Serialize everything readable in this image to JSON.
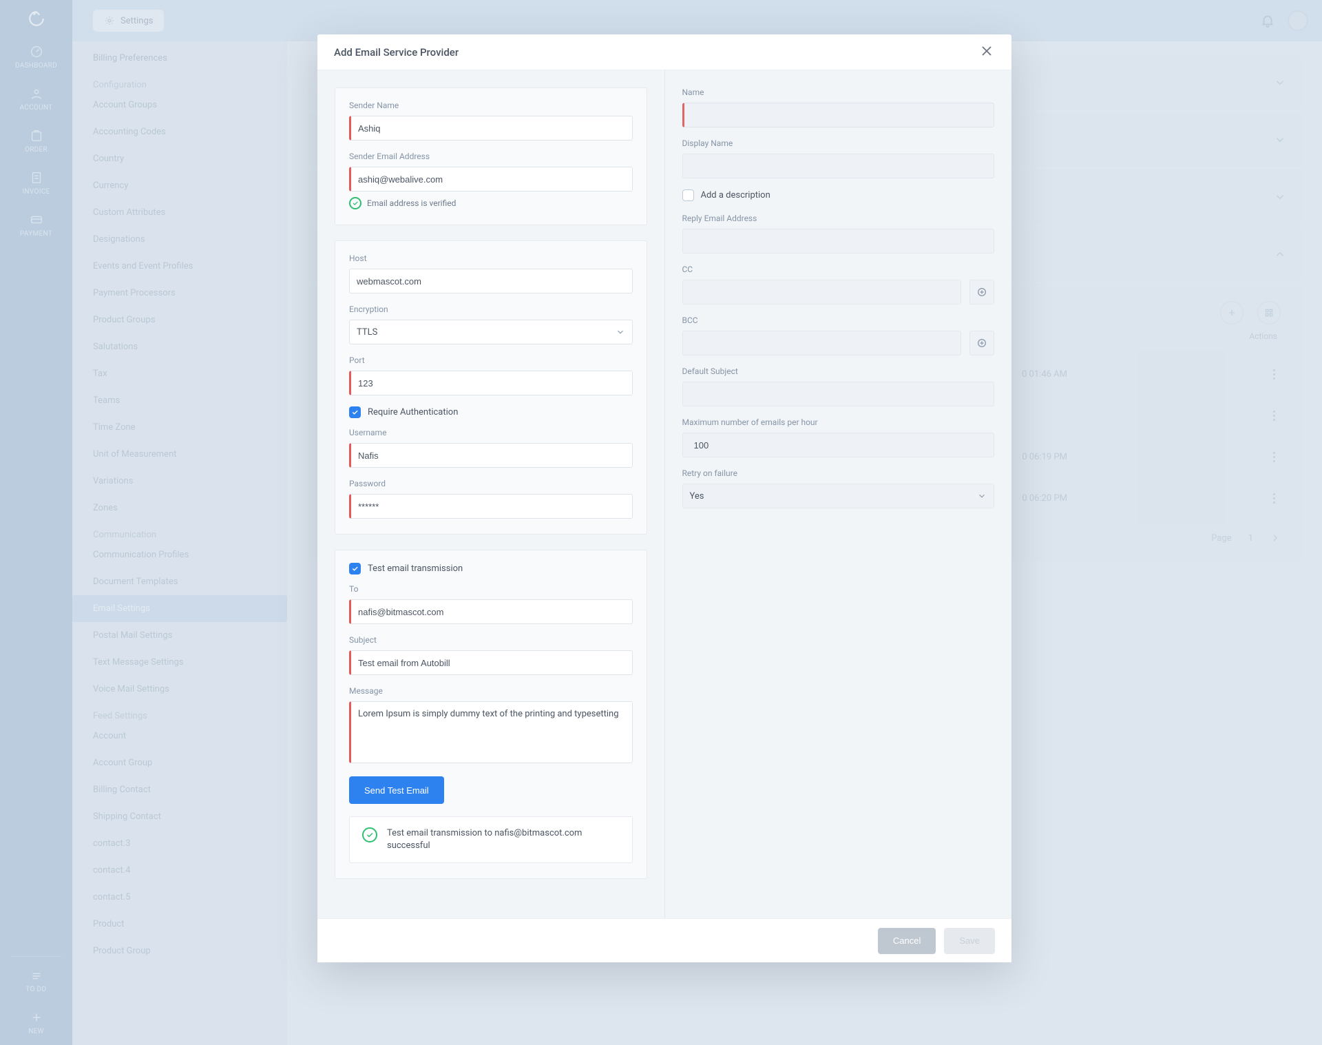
{
  "rail": {
    "items": [
      "DASHBOARD",
      "ACCOUNT",
      "ORDER",
      "INVOICE",
      "PAYMENT"
    ],
    "footer": [
      "TO DO",
      "NEW"
    ]
  },
  "top": {
    "tab_label": "Settings"
  },
  "sidebar": {
    "billing_head": "Billing Preferences",
    "config_head": "Configuration",
    "config_items": [
      "Account Groups",
      "Accounting Codes",
      "Country",
      "Currency",
      "Custom Attributes",
      "Designations",
      "Events and Event Profiles",
      "Payment Processors",
      "Product Groups",
      "Salutations",
      "Tax",
      "Teams",
      "Time Zone",
      "Unit of Measurement",
      "Variations",
      "Zones"
    ],
    "comm_head": "Communication",
    "comm_items": [
      "Communication Profiles",
      "Document Templates",
      "Email Settings",
      "Postal Mail Settings",
      "Text Message Settings",
      "Voice Mail Settings"
    ],
    "comm_active_index": 2,
    "feed_head": "Feed Settings",
    "feed_items": [
      "Account",
      "Account Group",
      "Billing Contact",
      "Shipping Contact",
      "contact.3",
      "contact.4",
      "contact.5",
      "Product",
      "Product Group"
    ]
  },
  "underlay": {
    "actions_label": "Actions",
    "logs": [
      "0 01:46 AM",
      "",
      "0 06:19 PM",
      "0 06:20 PM"
    ],
    "pager_label": "Page",
    "pager_value": "1"
  },
  "modal": {
    "title": "Add Email Service Provider",
    "left": {
      "sender_name_label": "Sender Name",
      "sender_name": "Ashiq",
      "sender_email_label": "Sender Email Address",
      "sender_email": "ashiq@webalive.com",
      "verified": "Email address is verified",
      "host_label": "Host",
      "host": "webmascot.com",
      "encryption_label": "Encryption",
      "encryption": "TTLS",
      "port_label": "Port",
      "port": "123",
      "require_auth": "Require Authentication",
      "username_label": "Username",
      "username": "Nafis",
      "password_label": "Password",
      "password": "******",
      "test_check": "Test email transmission",
      "to_label": "To",
      "to": "nafis@bitmascot.com",
      "subject_label": "Subject",
      "subject": "Test email from Autobill",
      "message_label": "Message",
      "message": "Lorem Ipsum is simply dummy text of the printing and typesetting",
      "send_btn": "Send Test Email",
      "info_msg": "Test email transmission to nafis@bitmascot.com successful"
    },
    "right": {
      "name_label": "Name",
      "display_label": "Display Name",
      "desc_check": "Add a description",
      "reply_label": "Reply Email Address",
      "cc_label": "CC",
      "bcc_label": "BCC",
      "subject_label": "Default Subject",
      "max_label": "Maximum number of emails per hour",
      "max": "100",
      "retry_label": "Retry on failure",
      "retry": "Yes"
    },
    "footer": {
      "cancel": "Cancel",
      "save": "Save"
    }
  }
}
